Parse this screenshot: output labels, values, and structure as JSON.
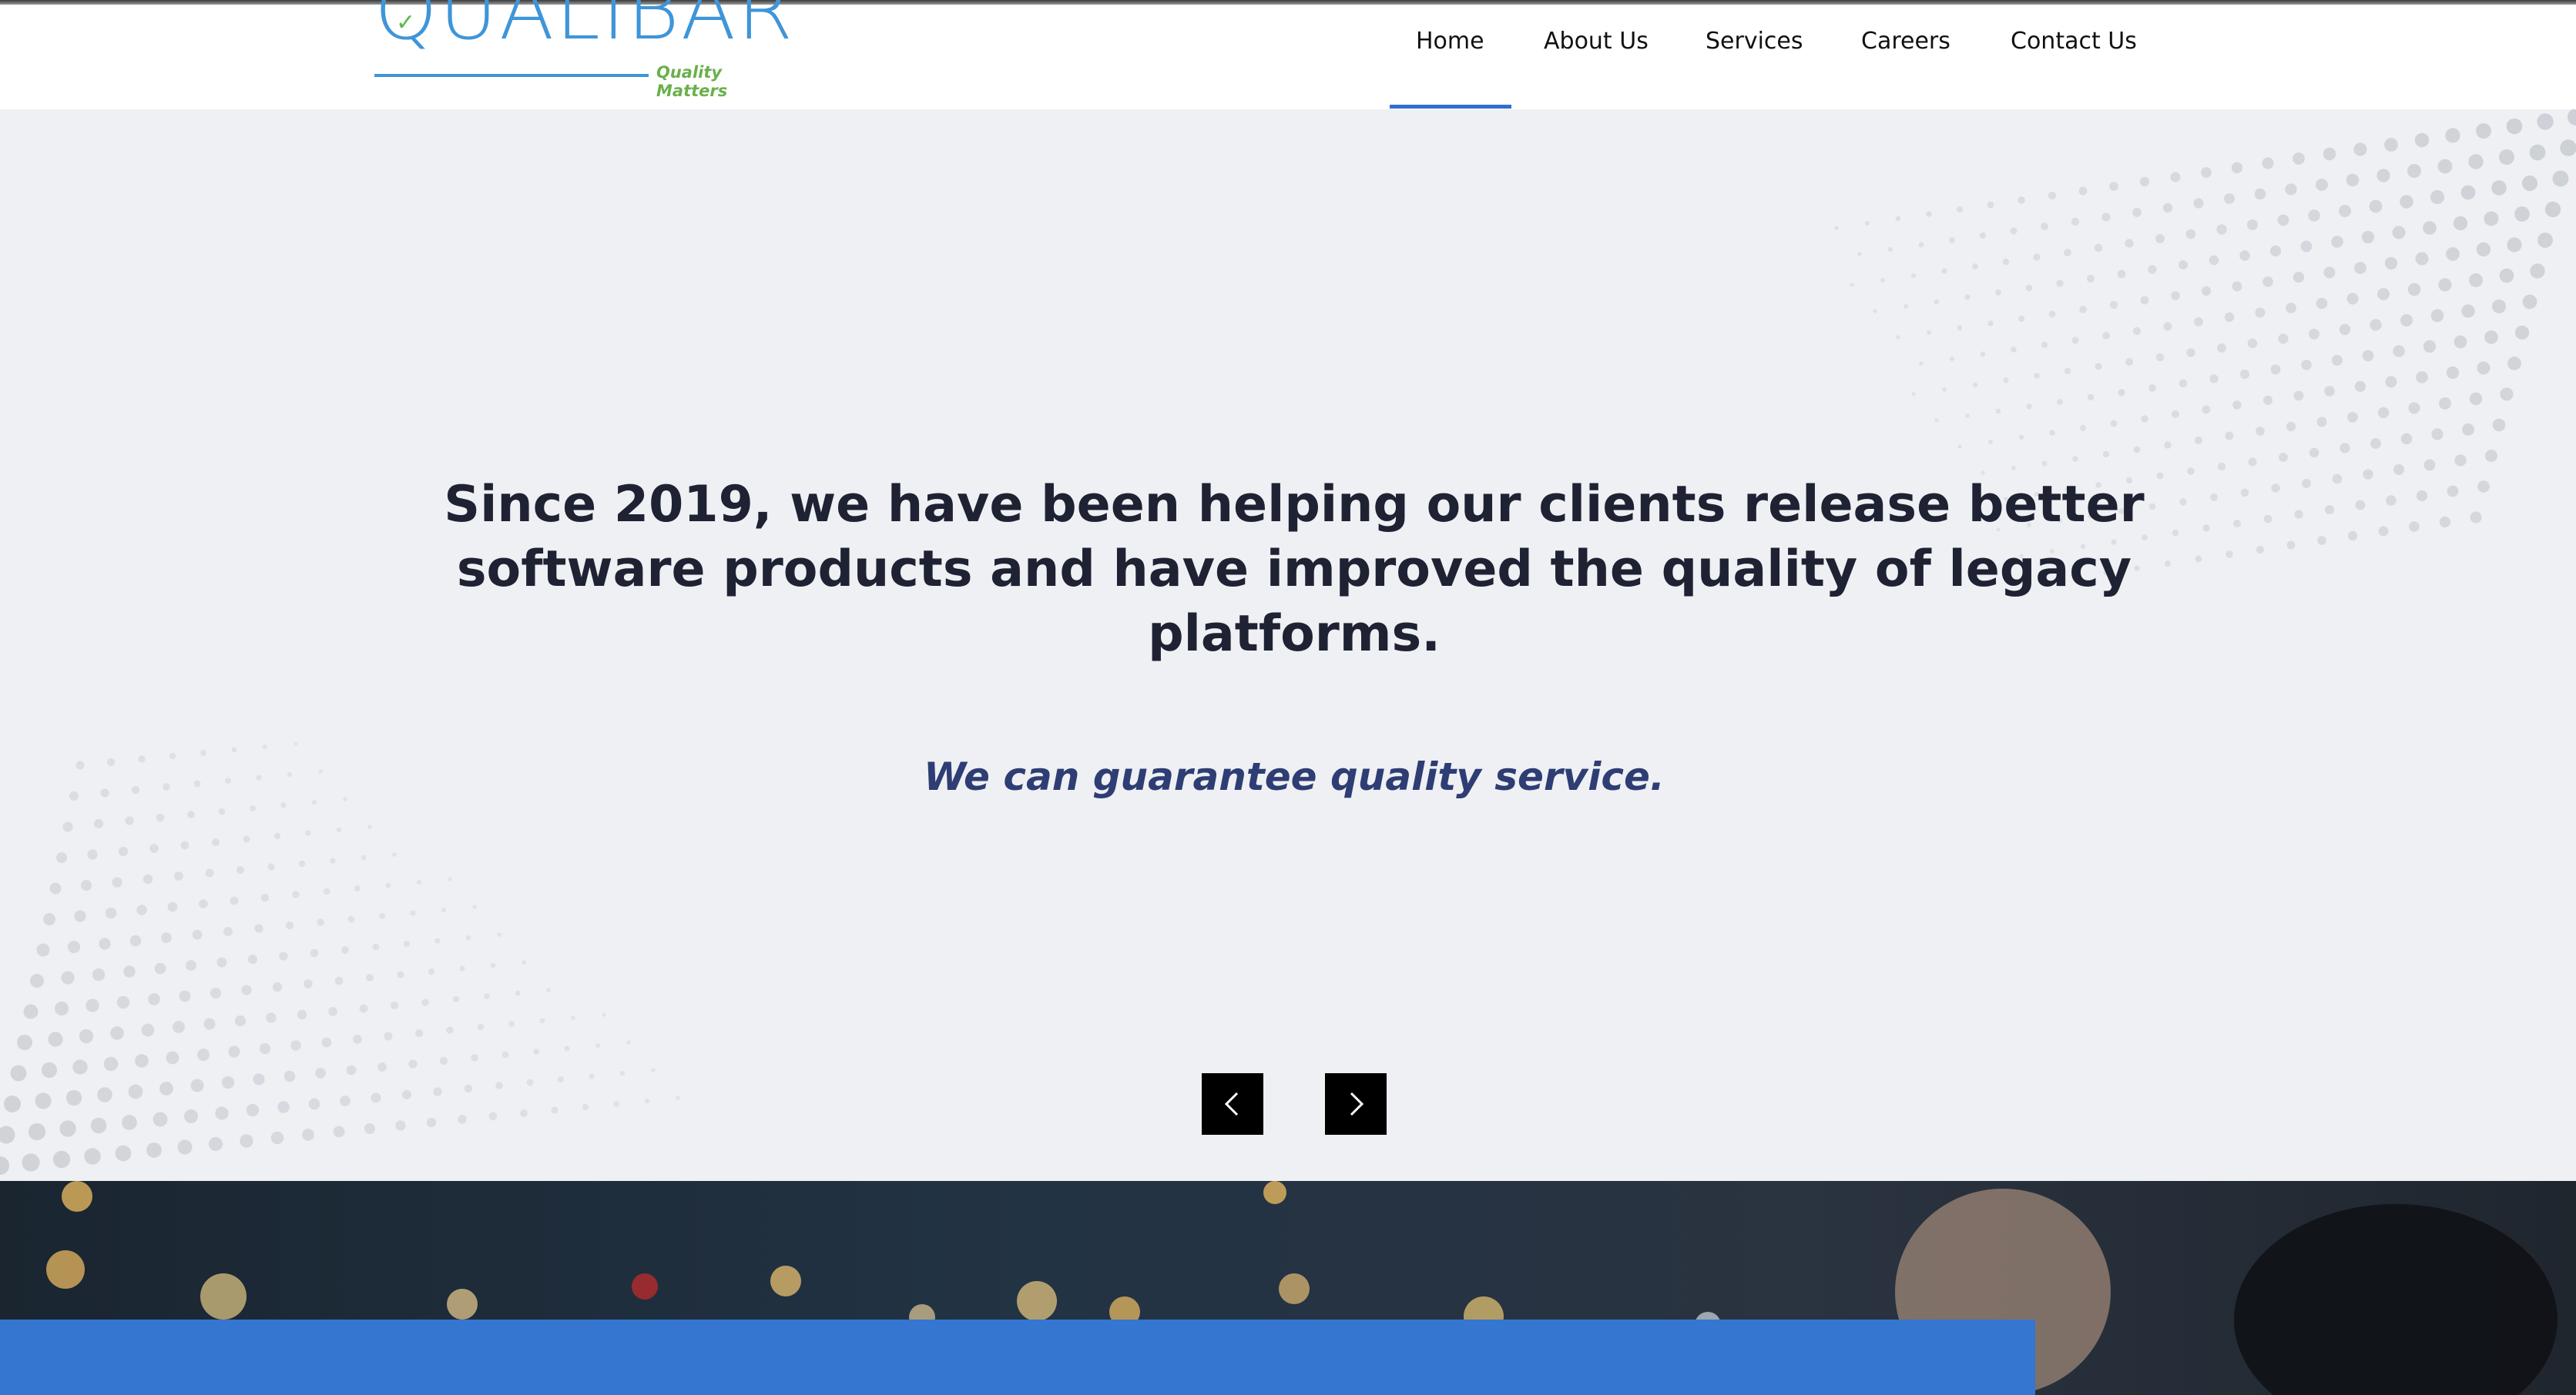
{
  "brand": {
    "logo_text": "QUALIBAR",
    "tagline": "Quality Matters",
    "primary_color": "#3f95d8",
    "accent_green": "#6ab04c"
  },
  "nav": {
    "items": [
      {
        "label": "Home",
        "active": true
      },
      {
        "label": "About Us"
      },
      {
        "label": "Services"
      },
      {
        "label": "Careers"
      },
      {
        "label": "Contact Us"
      }
    ],
    "active_color": "#2f6fd0"
  },
  "hero": {
    "headline": "Since 2019, we have been helping our clients release better software products and have improved the quality of legacy platforms.",
    "tagline": "We can guarantee quality service.",
    "prev_icon": "chevron-left-icon",
    "next_icon": "chevron-right-icon"
  },
  "colors": {
    "hero_bg": "#eef0f3",
    "headline": "#1e2233",
    "tagline": "#2e3d73",
    "cta_bar": "#3576d1"
  }
}
